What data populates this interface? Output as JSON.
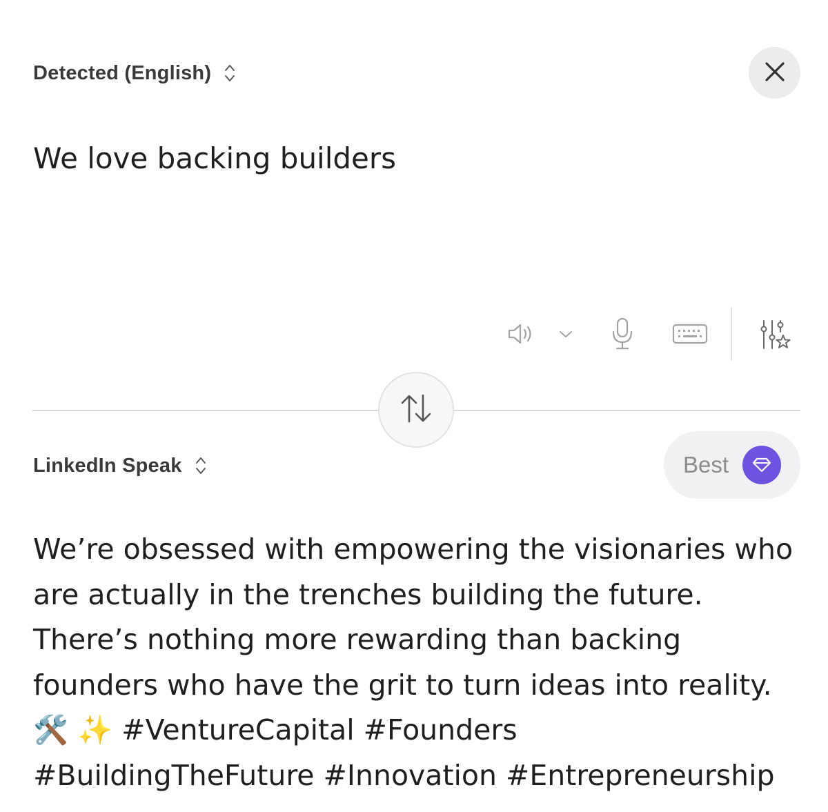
{
  "source": {
    "language_label": "Detected (English)",
    "text": "We love backing builders"
  },
  "target": {
    "language_label": "LinkedIn Speak",
    "quality_label": "Best",
    "output_lines": [
      "We’re obsessed with empowering the visionaries who",
      "are actually in the trenches building the future.",
      "There’s nothing more rewarding than backing",
      "founders who have the grit to turn ideas into reality.",
      "🛠️ ✨ #VentureCapital #Founders",
      "#BuildingTheFuture #Innovation #Entrepreneurship"
    ]
  },
  "toolbar": {
    "icons": [
      "speaker-icon",
      "chevron-down-icon",
      "microphone-icon",
      "keyboard-icon",
      "sliders-star-icon"
    ]
  },
  "icons": {
    "close": "close-icon",
    "swap": "swap-arrows-icon",
    "language_toggle": "chevron-updown-icon",
    "quality_badge": "gem-icon"
  },
  "colors": {
    "accent": "#6e52e0",
    "text": "#1f1f1f",
    "label": "#3a3a3a",
    "icon": "#9b9b9b",
    "divider": "#d9d9d9"
  }
}
